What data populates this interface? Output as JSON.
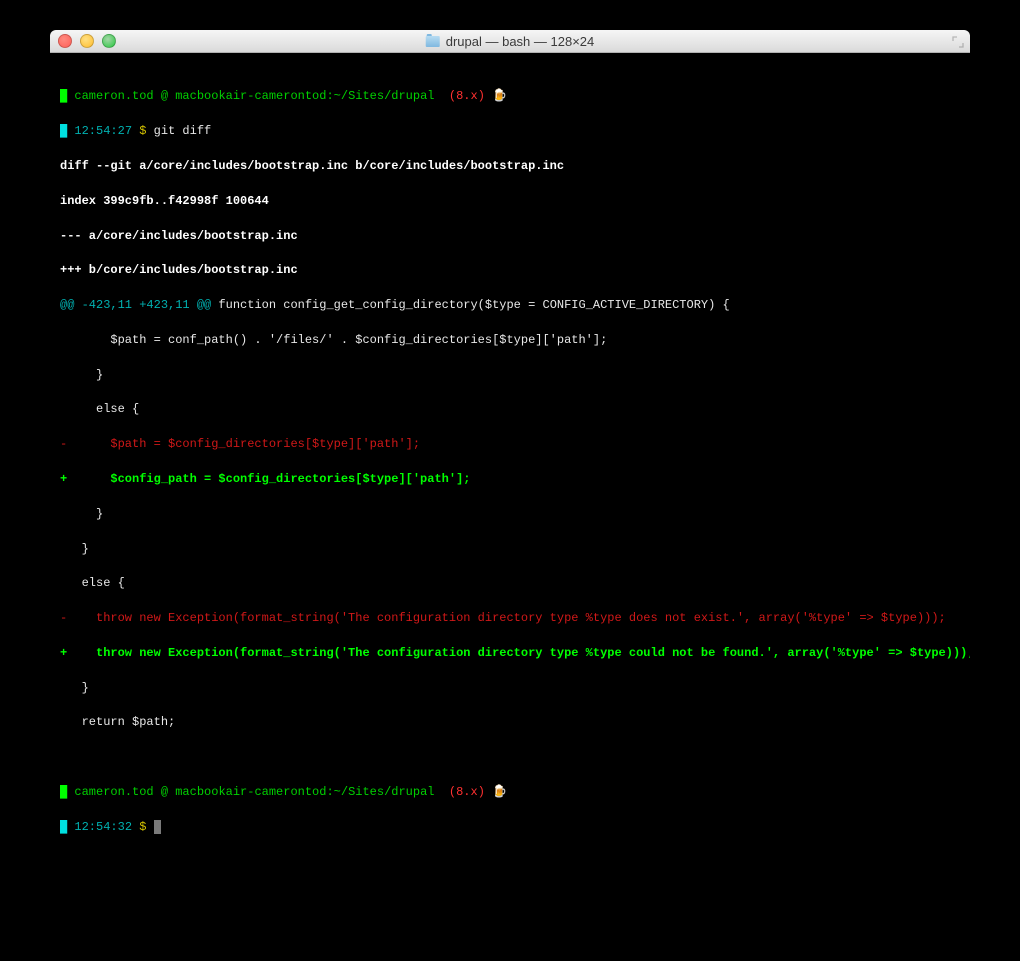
{
  "window": {
    "title": "drupal — bash — 128×24"
  },
  "prompt1": {
    "user": "cameron.tod",
    "at": " @ ",
    "host_path": "macbookair-camerontod:~/Sites/drupal",
    "branch": "  (8.x)",
    "beer": " 🍺",
    "time": "12:54:27",
    "dollar": " $ ",
    "command": "git diff"
  },
  "diff": {
    "l1": "diff --git a/core/includes/bootstrap.inc b/core/includes/bootstrap.inc",
    "l2": "index 399c9fb..f42998f 100644",
    "l3": "--- a/core/includes/bootstrap.inc",
    "l4": "+++ b/core/includes/bootstrap.inc",
    "hunk": "@@ -423,11 +423,11 @@",
    "hunk_ctx": " function config_get_config_directory($type = CONFIG_ACTIVE_DIRECTORY) {",
    "c1": "       $path = conf_path() . '/files/' . $config_directories[$type]['path'];",
    "c2": "     }",
    "c3": "     else {",
    "del1": "-      $path = $config_directories[$type]['path'];",
    "add1": "+      $config_path = $config_directories[$type]['path'];",
    "c4": "     }",
    "c5": "   }",
    "c6": "   else {",
    "del2": "-    throw new Exception(format_string('The configuration directory type %type does not exist.', array('%type' => $type)));",
    "add2": "+    throw new Exception(format_string('The configuration directory type %type could not be found.', array('%type' => $type)));",
    "c7": "   }",
    "c8": "   return $path;"
  },
  "prompt2": {
    "user": "cameron.tod",
    "at": " @ ",
    "host_path": "macbookair-camerontod:~/Sites/drupal",
    "branch": "  (8.x)",
    "beer": " 🍺",
    "time": "12:54:32",
    "dollar": " $ "
  }
}
